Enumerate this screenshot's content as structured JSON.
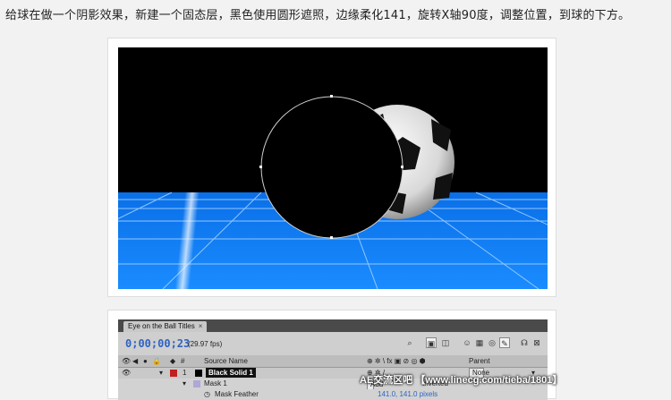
{
  "instruction": "给球在做一个阴影效果，新建一个固态层，黑色使用圆形遮照，边缘柔化141，旋转X轴90度，调整位置，到球的下方。",
  "panel": {
    "tab_title": "Eye on the Ball Titles",
    "timecode": "0;00;00;23",
    "fps": "(29.97 fps)",
    "header": {
      "source_name": "Source Name",
      "parent": "Parent"
    },
    "layer": {
      "number": "1",
      "name": "Black Solid 1",
      "color": "#c02020"
    },
    "mask": {
      "name": "Mask 1",
      "add_label": "Add",
      "mode_text": "Inverted"
    },
    "mask_feather": {
      "label": "Mask Feather",
      "value": "141.0, 141.0 pixels"
    },
    "parent_value": "None"
  },
  "watermark": "AE交流区吧 【www.linecg.com/tieba/1801】",
  "colors": {
    "grid_blue": "#1a86ff",
    "timecode_blue": "#2e63c4"
  }
}
